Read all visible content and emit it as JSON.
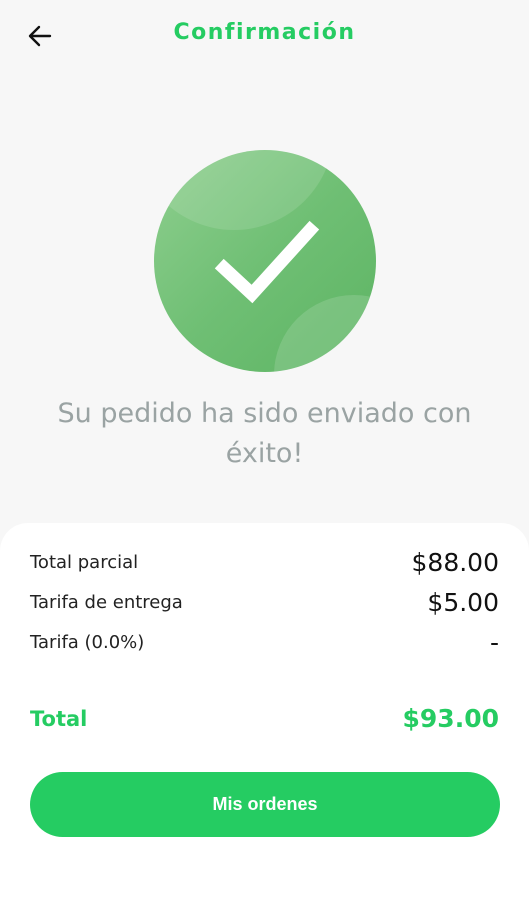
{
  "header": {
    "title": "Confirmación",
    "back_icon": "arrow-left-icon"
  },
  "success": {
    "icon": "checkmark-icon",
    "message": "Su pedido ha sido enviado con éxito!"
  },
  "summary": {
    "subtotal_label": "Total parcial",
    "subtotal_value": "$88.00",
    "delivery_label": "Tarifa de entrega",
    "delivery_value": "$5.00",
    "fee_label": "Tarifa (0.0%)",
    "fee_value": "-",
    "total_label": "Total",
    "total_value": "$93.00"
  },
  "actions": {
    "orders_label": "Mis ordenes"
  },
  "colors": {
    "accent": "#25cc62",
    "success_circle": "#6fbf74",
    "message_text": "#9aa3a3"
  }
}
